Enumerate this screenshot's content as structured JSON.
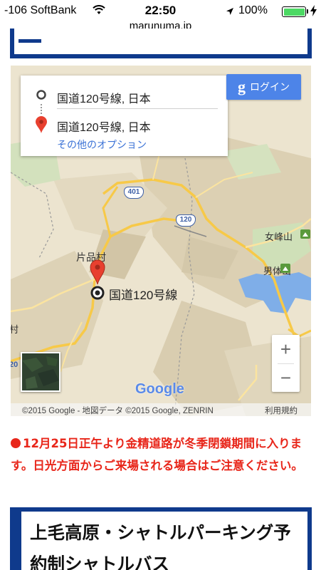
{
  "status_bar": {
    "carrier": "-106 SoftBank",
    "time": "22:50",
    "battery_percent": "100%",
    "icons": [
      "wifi-icon",
      "location-arrow-icon",
      "battery-icon",
      "charging-bolt-icon"
    ]
  },
  "browser": {
    "url": "marunuma.jp"
  },
  "map": {
    "directions": {
      "origin": "国道120号線, 日本",
      "destination": "国道120号線, 日本",
      "more_options": "その他のオプション"
    },
    "login_button": {
      "g_glyph": "g",
      "label": "ログイン"
    },
    "labels": {
      "village": "片品村",
      "marker_label": "国道120号線",
      "peak1": "女峰山",
      "peak2": "男体山",
      "edge_left": "村",
      "edge_left2": "20"
    },
    "route_shields": {
      "r401": "401",
      "r120": "120"
    },
    "zoom": {
      "in": "+",
      "out": "−"
    },
    "logo": "Google",
    "copyright": "©2015 Google - 地図データ ©2015 Google, ZENRIN",
    "terms": "利用規約",
    "colors": {
      "road_major": "#f7c948",
      "lake": "#7faee8",
      "terrain": "#e7dcc2",
      "marker": "#e8402f"
    }
  },
  "notice": {
    "text": "12月25日正午より金精道路が冬季閉鎖期間に入ります。日光方面からご来場される場合はご注意ください。",
    "color": "#e8261a"
  },
  "section": {
    "title": "上毛高原・シャトルパーキング予約制シャトルバス"
  }
}
